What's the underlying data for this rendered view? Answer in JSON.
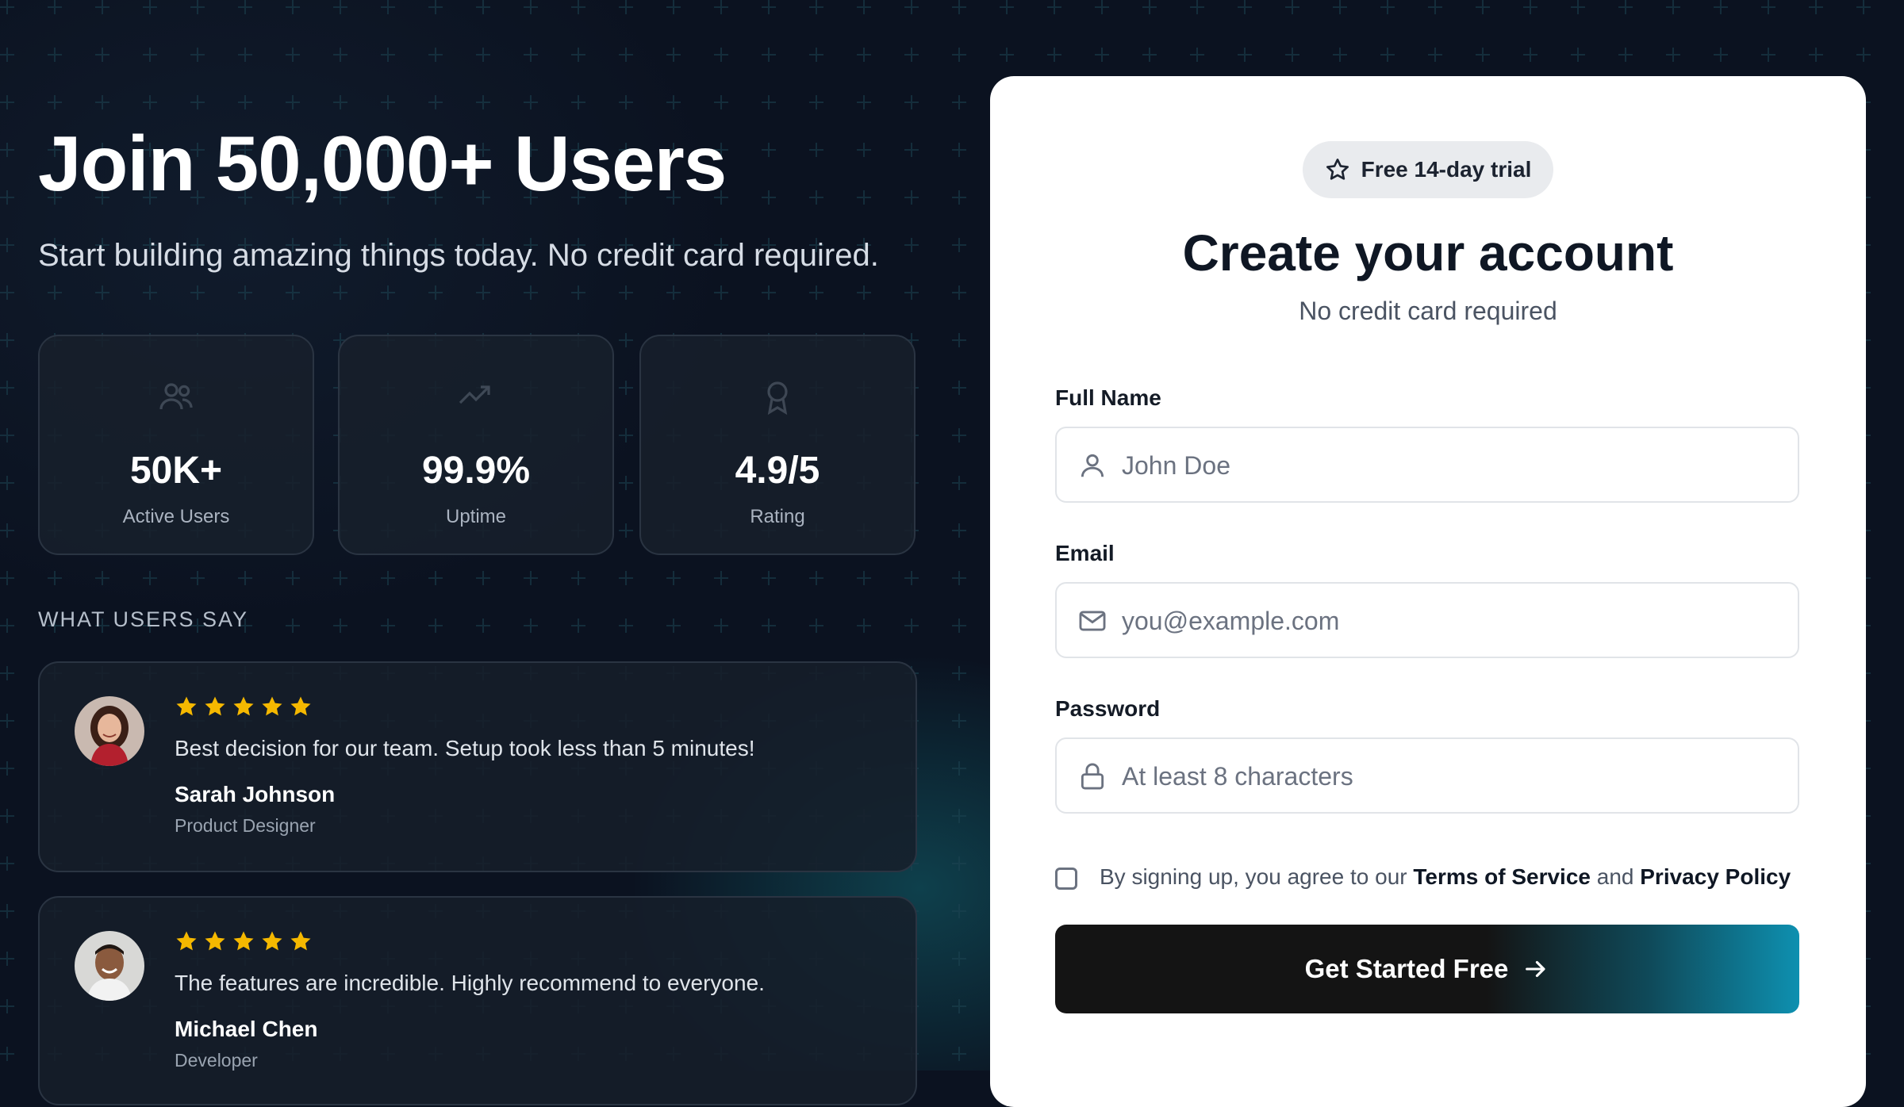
{
  "hero": {
    "headline": "Join 50,000+ Users",
    "subhead": "Start building amazing things today. No credit card required."
  },
  "stats": [
    {
      "value": "50K+",
      "label": "Active Users",
      "icon": "users-icon"
    },
    {
      "value": "99.9%",
      "label": "Uptime",
      "icon": "trending-icon"
    },
    {
      "value": "4.9/5",
      "label": "Rating",
      "icon": "award-icon"
    }
  ],
  "testimonials": {
    "title": "WHAT USERS SAY",
    "items": [
      {
        "rating": 5,
        "quote": "Best decision for our team. Setup took less than 5 minutes!",
        "name": "Sarah Johnson",
        "role": "Product Designer"
      },
      {
        "rating": 5,
        "quote": "The features are incredible. Highly recommend to everyone.",
        "name": "Michael Chen",
        "role": "Developer"
      }
    ]
  },
  "signup": {
    "badge": "Free 14-day trial",
    "title": "Create your account",
    "subtitle": "No credit card required",
    "fields": {
      "name": {
        "label": "Full Name",
        "placeholder": "John Doe",
        "value": ""
      },
      "email": {
        "label": "Email",
        "placeholder": "you@example.com",
        "value": ""
      },
      "password": {
        "label": "Password",
        "placeholder": "At least 8 characters",
        "value": ""
      }
    },
    "agree": {
      "prefix": "By signing up, you agree to our ",
      "terms": "Terms of Service",
      "and": " and ",
      "privacy": "Privacy Policy",
      "checked": false
    },
    "cta": "Get Started Free"
  },
  "colors": {
    "background": "#0b1220",
    "star": "#f5b800",
    "cta_dark": "#141414",
    "cta_accent": "#0e90b0"
  }
}
